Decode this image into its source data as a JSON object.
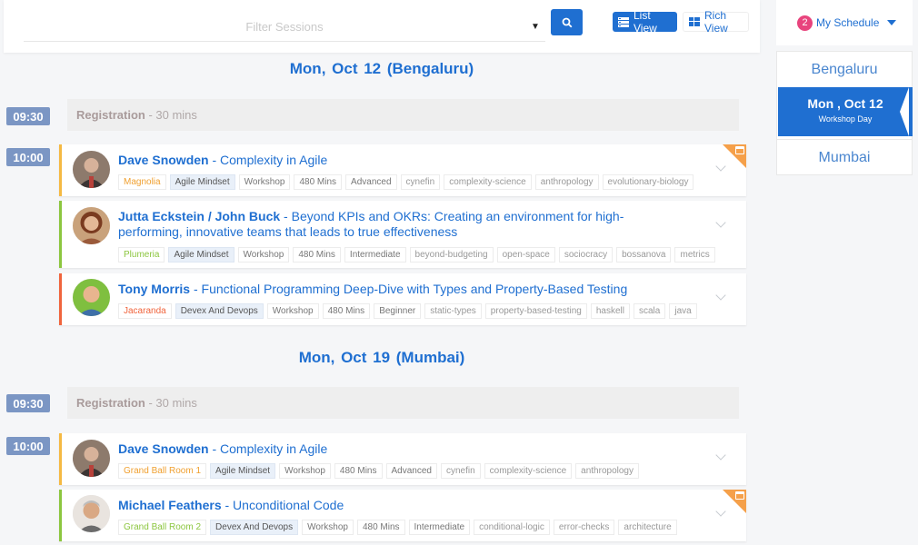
{
  "filter": {
    "placeholder": "Filter Sessions"
  },
  "views": {
    "list_label": "List View",
    "rich_label": "Rich View"
  },
  "schedule": {
    "count": "2",
    "label": "My Schedule"
  },
  "side": {
    "city1": "Bengaluru",
    "active_date": "Mon , Oct 12",
    "active_type": "Workshop Day",
    "city2": "Mumbai"
  },
  "colors": {
    "accent": "#1f6fd1",
    "badge": "#e8447d",
    "time": "#7b96c4",
    "corner": "#f5a04a"
  },
  "days": [
    {
      "heading": "Mon,  Oct  12  (Bengaluru)",
      "registration": {
        "time": "09:30",
        "label": "Registration",
        "duration": " - 30 mins"
      },
      "slot_time": "10:00",
      "sessions": [
        {
          "speaker": "Dave Snowden",
          "title": " - Complexity in Agile",
          "room": "Magnolia",
          "track": "Agile Mindset",
          "type": "Workshop",
          "duration": "480 Mins",
          "level": "Advanced",
          "keywords": [
            "cynefin",
            "complexity-science",
            "anthropology",
            "evolutionary-biology"
          ]
        },
        {
          "speaker": "Jutta Eckstein / John Buck",
          "title": " - Beyond KPIs and OKRs: Creating an environment for high-performing, innovative teams that leads to true effectiveness",
          "room": "Plumeria",
          "track": "Agile Mindset",
          "type": "Workshop",
          "duration": "480 Mins",
          "level": "Intermediate",
          "keywords": [
            "beyond-budgeting",
            "open-space",
            "sociocracy",
            "bossanova",
            "metrics"
          ]
        },
        {
          "speaker": "Tony Morris",
          "title": " - Functional Programming Deep-Dive with Types and Property-Based Testing",
          "room": "Jacaranda",
          "track": "Devex And Devops",
          "type": "Workshop",
          "duration": "480 Mins",
          "level": "Beginner",
          "keywords": [
            "static-types",
            "property-based-testing",
            "haskell",
            "scala",
            "java"
          ]
        }
      ]
    },
    {
      "heading": "Mon,  Oct  19  (Mumbai)",
      "registration": {
        "time": "09:30",
        "label": "Registration",
        "duration": " - 30 mins"
      },
      "slot_time": "10:00",
      "sessions": [
        {
          "speaker": "Dave Snowden",
          "title": " - Complexity in Agile",
          "room": "Grand Ball Room 1",
          "track": "Agile Mindset",
          "type": "Workshop",
          "duration": "480 Mins",
          "level": "Advanced",
          "keywords": [
            "cynefin",
            "complexity-science",
            "anthropology"
          ]
        },
        {
          "speaker": "Michael Feathers",
          "title": " - Unconditional Code",
          "room": "Grand Ball Room 2",
          "track": "Devex And Devops",
          "type": "Workshop",
          "duration": "480 Mins",
          "level": "Intermediate",
          "keywords": [
            "conditional-logic",
            "error-checks",
            "architecture"
          ]
        }
      ]
    }
  ]
}
